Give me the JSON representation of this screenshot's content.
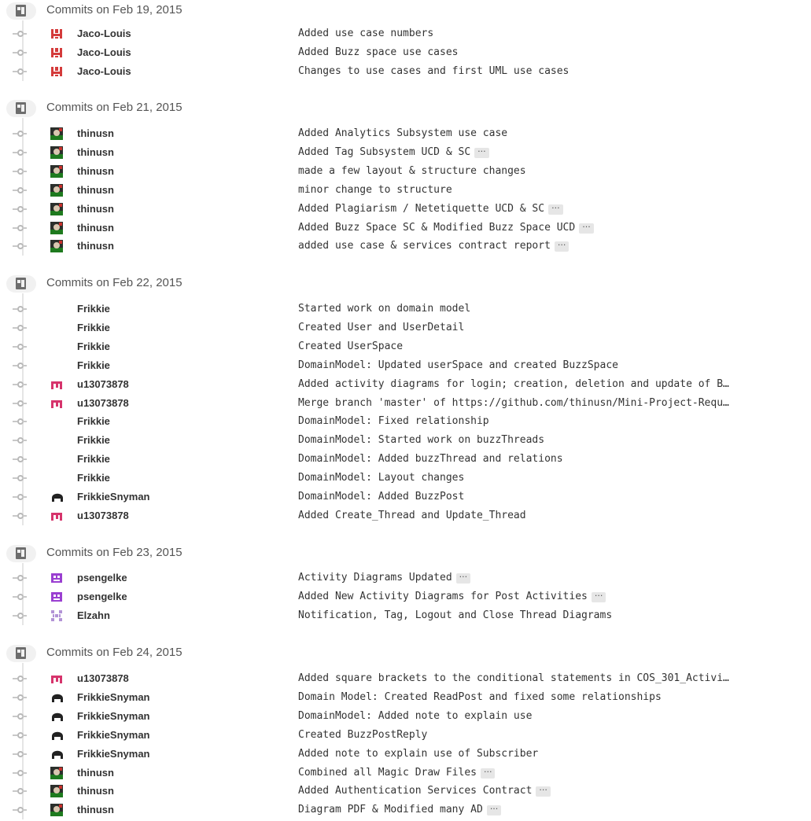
{
  "colors": {
    "timeline_line": "#e5e5e5",
    "header_icon_bg": "#f1f1f1",
    "ellipsis_bg": "#e6e6e6",
    "avatar_jaco": "#d43b3b",
    "avatar_thinusn": "#1e7a1e",
    "avatar_u13": "#d6346c",
    "avatar_psengelke": "#9a3fd1",
    "avatar_elzahn": "#b293d6",
    "avatar_frikkiesnyman": "#222222"
  },
  "ellipsis_label": "···",
  "groups": [
    {
      "title": "Commits on Feb 19, 2015",
      "commits": [
        {
          "author": "Jaco-Louis",
          "avatar": "jaco-avatar-icon",
          "message": "Added use case numbers",
          "expand": false
        },
        {
          "author": "Jaco-Louis",
          "avatar": "jaco-avatar-icon",
          "message": "Added Buzz space use cases",
          "expand": false
        },
        {
          "author": "Jaco-Louis",
          "avatar": "jaco-avatar-icon",
          "message": "Changes to use cases and first UML use cases",
          "expand": false
        }
      ]
    },
    {
      "title": "Commits on Feb 21, 2015",
      "commits": [
        {
          "author": "thinusn",
          "avatar": "thinusn-avatar-icon",
          "message": "Added Analytics Subsystem use case",
          "expand": false
        },
        {
          "author": "thinusn",
          "avatar": "thinusn-avatar-icon",
          "message": "Added Tag Subsystem UCD & SC",
          "expand": true
        },
        {
          "author": "thinusn",
          "avatar": "thinusn-avatar-icon",
          "message": "made a few layout & structure changes",
          "expand": false
        },
        {
          "author": "thinusn",
          "avatar": "thinusn-avatar-icon",
          "message": "minor change to structure",
          "expand": false
        },
        {
          "author": "thinusn",
          "avatar": "thinusn-avatar-icon",
          "message": "Added Plagiarism / Netetiquette UCD & SC",
          "expand": true
        },
        {
          "author": "thinusn",
          "avatar": "thinusn-avatar-icon",
          "message": "Added Buzz Space SC & Modified Buzz Space UCD",
          "expand": true
        },
        {
          "author": "thinusn",
          "avatar": "thinusn-avatar-icon",
          "message": "added use case & services contract report",
          "expand": true
        }
      ]
    },
    {
      "title": "Commits on Feb 22, 2015",
      "commits": [
        {
          "author": "Frikkie",
          "avatar": "",
          "message": "Started work on domain model",
          "expand": false
        },
        {
          "author": "Frikkie",
          "avatar": "",
          "message": "Created User and UserDetail",
          "expand": false
        },
        {
          "author": "Frikkie",
          "avatar": "",
          "message": "Created UserSpace",
          "expand": false
        },
        {
          "author": "Frikkie",
          "avatar": "",
          "message": "DomainModel: Updated userSpace and created BuzzSpace",
          "expand": false
        },
        {
          "author": "u13073878",
          "avatar": "u13073878-avatar-icon",
          "message": "Added activity diagrams for login; creation, deletion and update of B…",
          "expand": false
        },
        {
          "author": "u13073878",
          "avatar": "u13073878-avatar-icon",
          "message": "Merge branch 'master' of https://github.com/thinusn/Mini-Project-Requ…",
          "expand": false
        },
        {
          "author": "Frikkie",
          "avatar": "",
          "message": "DomainModel: Fixed relationship",
          "expand": false
        },
        {
          "author": "Frikkie",
          "avatar": "",
          "message": "DomainModel: Started work on buzzThreads",
          "expand": false
        },
        {
          "author": "Frikkie",
          "avatar": "",
          "message": "DomainModel: Added buzzThread and relations",
          "expand": false
        },
        {
          "author": "Frikkie",
          "avatar": "",
          "message": "DomainModel: Layout changes",
          "expand": false
        },
        {
          "author": "FrikkieSnyman",
          "avatar": "frikkiesnyman-avatar-icon",
          "message": "DomainModel: Added BuzzPost",
          "expand": false
        },
        {
          "author": "u13073878",
          "avatar": "u13073878-avatar-icon",
          "message": "Added Create_Thread and Update_Thread",
          "expand": false
        }
      ]
    },
    {
      "title": "Commits on Feb 23, 2015",
      "commits": [
        {
          "author": "psengelke",
          "avatar": "psengelke-avatar-icon",
          "message": "Activity Diagrams Updated",
          "expand": true
        },
        {
          "author": "psengelke",
          "avatar": "psengelke-avatar-icon",
          "message": "Added New Activity Diagrams for Post Activities",
          "expand": true
        },
        {
          "author": "Elzahn",
          "avatar": "elzahn-avatar-icon",
          "message": "Notification, Tag, Logout and Close Thread Diagrams",
          "expand": false
        }
      ]
    },
    {
      "title": "Commits on Feb 24, 2015",
      "commits": [
        {
          "author": "u13073878",
          "avatar": "u13073878-avatar-icon",
          "message": "Added square brackets to the conditional statements in COS_301_Activi…",
          "expand": false
        },
        {
          "author": "FrikkieSnyman",
          "avatar": "frikkiesnyman-avatar-icon",
          "message": "Domain Model: Created ReadPost and fixed some relationships",
          "expand": false
        },
        {
          "author": "FrikkieSnyman",
          "avatar": "frikkiesnyman-avatar-icon",
          "message": "DomainModel: Added note to explain use",
          "expand": false
        },
        {
          "author": "FrikkieSnyman",
          "avatar": "frikkiesnyman-avatar-icon",
          "message": "Created BuzzPostReply",
          "expand": false
        },
        {
          "author": "FrikkieSnyman",
          "avatar": "frikkiesnyman-avatar-icon",
          "message": "Added note to explain use of Subscriber",
          "expand": false
        },
        {
          "author": "thinusn",
          "avatar": "thinusn-avatar-icon",
          "message": "Combined all Magic Draw Files",
          "expand": true
        },
        {
          "author": "thinusn",
          "avatar": "thinusn-avatar-icon",
          "message": "Added Authentication Services Contract",
          "expand": true
        },
        {
          "author": "thinusn",
          "avatar": "thinusn-avatar-icon",
          "message": "Diagram PDF & Modified many AD",
          "expand": true
        }
      ]
    }
  ]
}
